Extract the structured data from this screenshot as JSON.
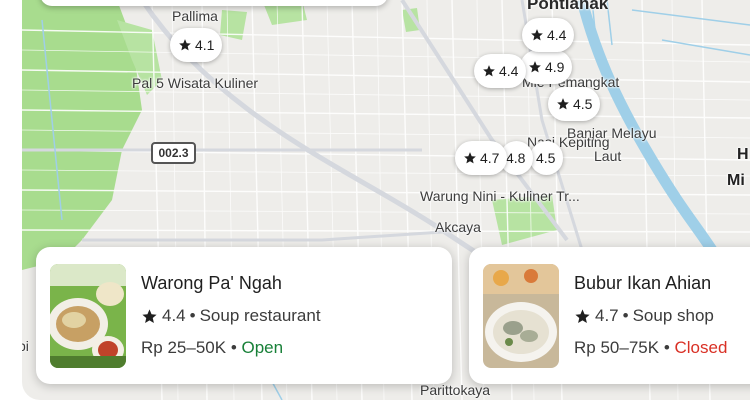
{
  "map": {
    "labels": {
      "pallima": "Pallima",
      "pontianak": "Pontianak",
      "pal5": "Pal 5 Wisata Kuliner",
      "mie_pemangkat": "Mie Pemangkat",
      "banjar_melayu": "Banjar Melayu",
      "laut": "Laut",
      "nasi_kepiting": "Nasi Kepiting",
      "warung_nini": "Warung Nini - Kuliner Tr...",
      "akcaya": "Akcaya",
      "right_h": "H",
      "right_mi": "Mi",
      "left_bi": "bi",
      "parittokaya": "Parittokaya"
    },
    "road_shield": "002.3",
    "colors": {
      "land": "#eeedea",
      "park": "#a8dc8e",
      "water": "#9fcfe8",
      "road": "#ffffff",
      "major_road": "#c8cdd6"
    },
    "pins": [
      {
        "rating": "4.1"
      },
      {
        "rating": "4.4"
      },
      {
        "rating": "4.9"
      },
      {
        "rating": "4.4"
      },
      {
        "rating": "4.5"
      },
      {
        "rating": "4.7"
      },
      {
        "rating": "4.8"
      },
      {
        "rating": "4.5"
      }
    ]
  },
  "cards": [
    {
      "name": "Warong Pa' Ngah",
      "rating": "4.4",
      "category": "Soup restaurant",
      "price": "Rp 25–50K",
      "status": "Open",
      "separator": "•"
    },
    {
      "name": "Bubur Ikan Ahian",
      "rating": "4.7",
      "category": "Soup shop",
      "price": "Rp 50–75K",
      "status": "Closed",
      "separator": "•"
    }
  ]
}
